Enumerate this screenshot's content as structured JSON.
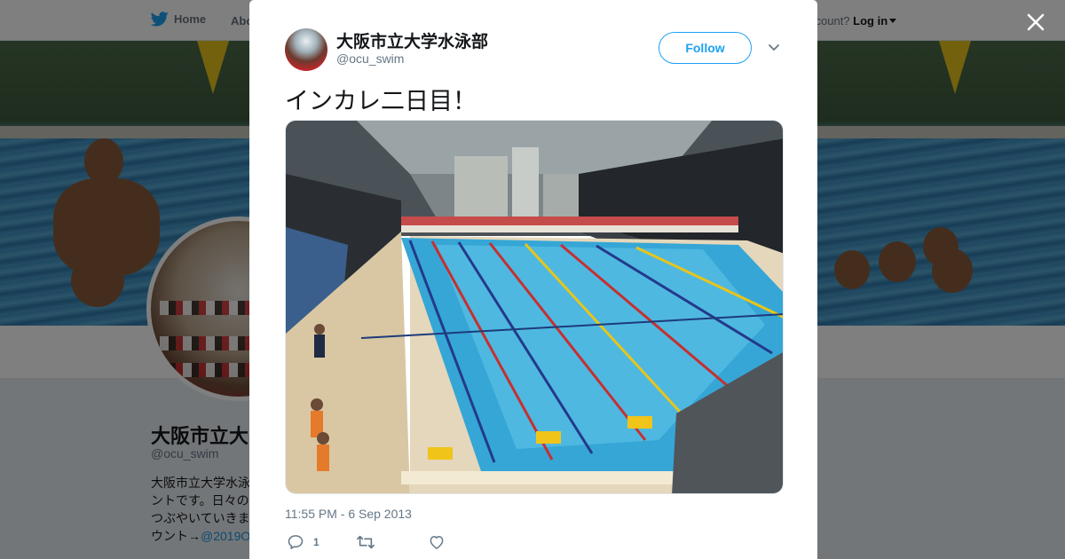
{
  "topbar": {
    "home_label": "Home",
    "about_label": "Abo",
    "account_prompt": "ccount?",
    "login_label": "Log in"
  },
  "profile_background": {
    "name": "大阪市立大学",
    "handle": "@ocu_swim",
    "bio_lines": [
      "大阪市立大学水泳",
      "ントです。日々の",
      "つぶやいていきま",
      "ウント→"
    ],
    "bio_link": "@2019O"
  },
  "tweet": {
    "author_name": "大阪市立大学水泳部",
    "author_handle": "@ocu_swim",
    "follow_label": "Follow",
    "text": "インカレ二日目！",
    "timestamp": "11:55 PM - 6 Sep 2013",
    "reply_count": "1",
    "retweet_count": "",
    "like_count": ""
  },
  "icons": {
    "brand": "twitter-bird-icon",
    "close": "close-icon",
    "more": "chevron-down-icon",
    "reply": "reply-icon",
    "retweet": "retweet-icon",
    "like": "heart-icon"
  },
  "colors": {
    "accent": "#1da1f2",
    "text": "#14171a",
    "muted": "#657786",
    "overlay": "rgba(0,0,0,0.5)"
  }
}
